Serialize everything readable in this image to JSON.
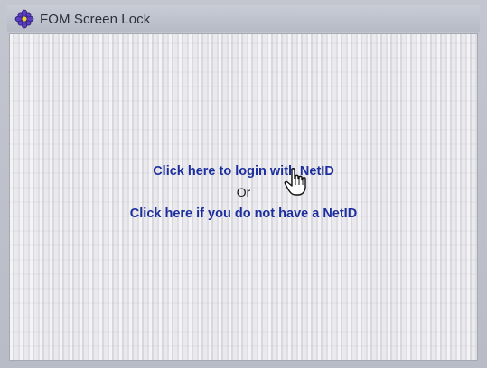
{
  "window": {
    "title": "FOM Screen Lock",
    "icon": "app-logo-icon"
  },
  "main": {
    "login_link": "Click here to login with NetID",
    "separator": "Or",
    "no_netid_link": "Click here if you do not have a NetID"
  },
  "pointer": {
    "icon": "hand-pointer-icon"
  },
  "colors": {
    "link": "#1d2f9e",
    "background": "#e6e6ea",
    "titlebar": "#c0c3cd"
  }
}
